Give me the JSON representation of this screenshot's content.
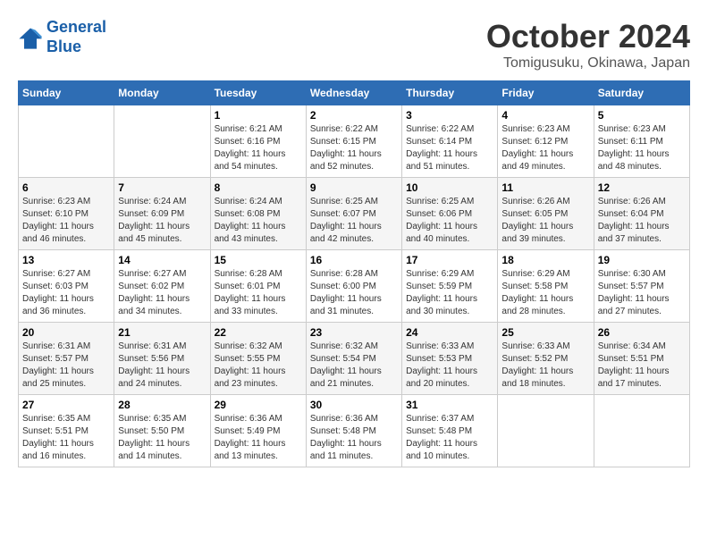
{
  "logo": {
    "line1": "General",
    "line2": "Blue"
  },
  "title": "October 2024",
  "subtitle": "Tomigusuku, Okinawa, Japan",
  "header": {
    "colors": {
      "bg": "#2e6db4"
    }
  },
  "weekdays": [
    "Sunday",
    "Monday",
    "Tuesday",
    "Wednesday",
    "Thursday",
    "Friday",
    "Saturday"
  ],
  "weeks": [
    [
      {
        "day": "",
        "info": ""
      },
      {
        "day": "",
        "info": ""
      },
      {
        "day": "1",
        "info": "Sunrise: 6:21 AM\nSunset: 6:16 PM\nDaylight: 11 hours and 54 minutes."
      },
      {
        "day": "2",
        "info": "Sunrise: 6:22 AM\nSunset: 6:15 PM\nDaylight: 11 hours and 52 minutes."
      },
      {
        "day": "3",
        "info": "Sunrise: 6:22 AM\nSunset: 6:14 PM\nDaylight: 11 hours and 51 minutes."
      },
      {
        "day": "4",
        "info": "Sunrise: 6:23 AM\nSunset: 6:12 PM\nDaylight: 11 hours and 49 minutes."
      },
      {
        "day": "5",
        "info": "Sunrise: 6:23 AM\nSunset: 6:11 PM\nDaylight: 11 hours and 48 minutes."
      }
    ],
    [
      {
        "day": "6",
        "info": "Sunrise: 6:23 AM\nSunset: 6:10 PM\nDaylight: 11 hours and 46 minutes."
      },
      {
        "day": "7",
        "info": "Sunrise: 6:24 AM\nSunset: 6:09 PM\nDaylight: 11 hours and 45 minutes."
      },
      {
        "day": "8",
        "info": "Sunrise: 6:24 AM\nSunset: 6:08 PM\nDaylight: 11 hours and 43 minutes."
      },
      {
        "day": "9",
        "info": "Sunrise: 6:25 AM\nSunset: 6:07 PM\nDaylight: 11 hours and 42 minutes."
      },
      {
        "day": "10",
        "info": "Sunrise: 6:25 AM\nSunset: 6:06 PM\nDaylight: 11 hours and 40 minutes."
      },
      {
        "day": "11",
        "info": "Sunrise: 6:26 AM\nSunset: 6:05 PM\nDaylight: 11 hours and 39 minutes."
      },
      {
        "day": "12",
        "info": "Sunrise: 6:26 AM\nSunset: 6:04 PM\nDaylight: 11 hours and 37 minutes."
      }
    ],
    [
      {
        "day": "13",
        "info": "Sunrise: 6:27 AM\nSunset: 6:03 PM\nDaylight: 11 hours and 36 minutes."
      },
      {
        "day": "14",
        "info": "Sunrise: 6:27 AM\nSunset: 6:02 PM\nDaylight: 11 hours and 34 minutes."
      },
      {
        "day": "15",
        "info": "Sunrise: 6:28 AM\nSunset: 6:01 PM\nDaylight: 11 hours and 33 minutes."
      },
      {
        "day": "16",
        "info": "Sunrise: 6:28 AM\nSunset: 6:00 PM\nDaylight: 11 hours and 31 minutes."
      },
      {
        "day": "17",
        "info": "Sunrise: 6:29 AM\nSunset: 5:59 PM\nDaylight: 11 hours and 30 minutes."
      },
      {
        "day": "18",
        "info": "Sunrise: 6:29 AM\nSunset: 5:58 PM\nDaylight: 11 hours and 28 minutes."
      },
      {
        "day": "19",
        "info": "Sunrise: 6:30 AM\nSunset: 5:57 PM\nDaylight: 11 hours and 27 minutes."
      }
    ],
    [
      {
        "day": "20",
        "info": "Sunrise: 6:31 AM\nSunset: 5:57 PM\nDaylight: 11 hours and 25 minutes."
      },
      {
        "day": "21",
        "info": "Sunrise: 6:31 AM\nSunset: 5:56 PM\nDaylight: 11 hours and 24 minutes."
      },
      {
        "day": "22",
        "info": "Sunrise: 6:32 AM\nSunset: 5:55 PM\nDaylight: 11 hours and 23 minutes."
      },
      {
        "day": "23",
        "info": "Sunrise: 6:32 AM\nSunset: 5:54 PM\nDaylight: 11 hours and 21 minutes."
      },
      {
        "day": "24",
        "info": "Sunrise: 6:33 AM\nSunset: 5:53 PM\nDaylight: 11 hours and 20 minutes."
      },
      {
        "day": "25",
        "info": "Sunrise: 6:33 AM\nSunset: 5:52 PM\nDaylight: 11 hours and 18 minutes."
      },
      {
        "day": "26",
        "info": "Sunrise: 6:34 AM\nSunset: 5:51 PM\nDaylight: 11 hours and 17 minutes."
      }
    ],
    [
      {
        "day": "27",
        "info": "Sunrise: 6:35 AM\nSunset: 5:51 PM\nDaylight: 11 hours and 16 minutes."
      },
      {
        "day": "28",
        "info": "Sunrise: 6:35 AM\nSunset: 5:50 PM\nDaylight: 11 hours and 14 minutes."
      },
      {
        "day": "29",
        "info": "Sunrise: 6:36 AM\nSunset: 5:49 PM\nDaylight: 11 hours and 13 minutes."
      },
      {
        "day": "30",
        "info": "Sunrise: 6:36 AM\nSunset: 5:48 PM\nDaylight: 11 hours and 11 minutes."
      },
      {
        "day": "31",
        "info": "Sunrise: 6:37 AM\nSunset: 5:48 PM\nDaylight: 11 hours and 10 minutes."
      },
      {
        "day": "",
        "info": ""
      },
      {
        "day": "",
        "info": ""
      }
    ]
  ]
}
